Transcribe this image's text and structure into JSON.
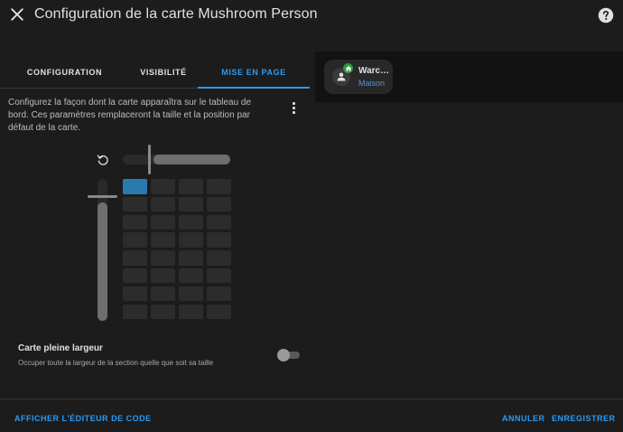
{
  "dialog": {
    "title": "Configuration de la carte Mushroom Person"
  },
  "tabs": [
    {
      "label": "CONFIGURATION",
      "active": false
    },
    {
      "label": "VISIBILITÉ",
      "active": false
    },
    {
      "label": "MISE EN PAGE",
      "active": true
    }
  ],
  "layout": {
    "description": "Configurez la façon dont la carte apparaîtra sur le tableau de bord. Ces paramètres remplaceront la taille et la position par défaut de la carte.",
    "grid": {
      "columns": 4,
      "rows": 8,
      "selected_columns": 1,
      "selected_rows": 1
    },
    "full_width": {
      "title": "Carte pleine largeur",
      "subtitle": "Occuper toute la largeur de la section quelle que soit sa taille",
      "enabled": false
    }
  },
  "preview": {
    "name": "Warc…",
    "state": "Maison"
  },
  "footer": {
    "code_label": "AFFICHER L'ÉDITEUR DE CODE",
    "cancel_label": "ANNULER",
    "save_label": "ENREGISTRER"
  },
  "colors": {
    "accent": "#2b9af3",
    "selected_cell": "#2a7ab0",
    "home_badge": "#2e9a3f",
    "state_text": "#5b8ed6"
  },
  "icons": [
    "close-icon",
    "help-icon",
    "dots-vertical-icon",
    "reset-icon",
    "account-icon",
    "home-icon"
  ]
}
